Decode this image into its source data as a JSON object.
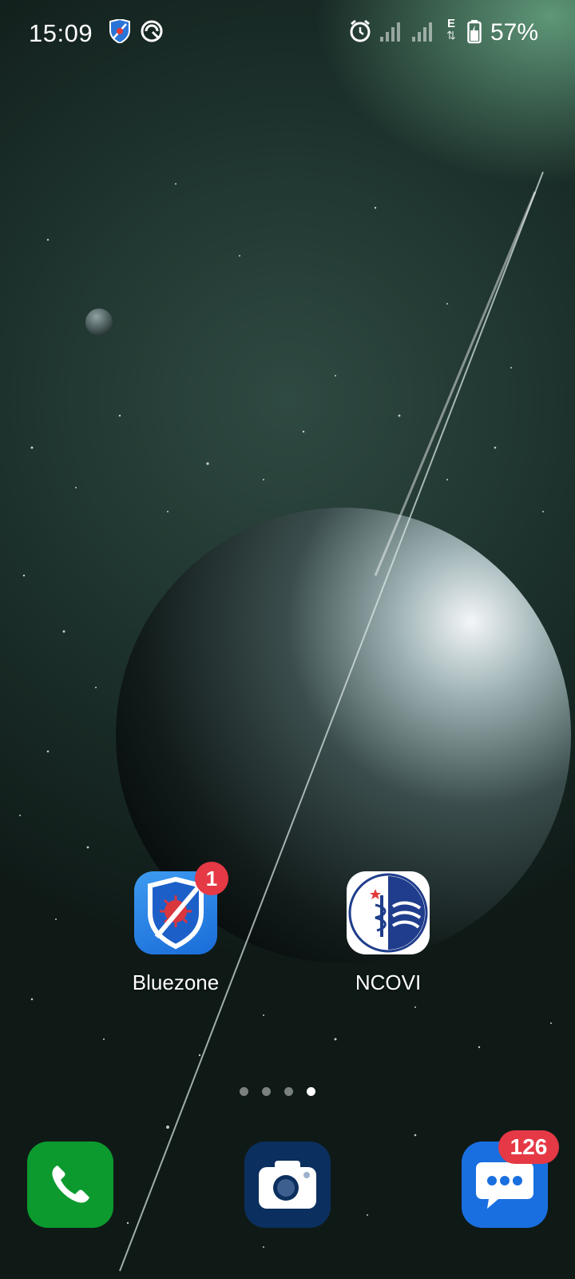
{
  "status_bar": {
    "time": "15:09",
    "battery_percent": "57%",
    "network_type": "E",
    "icons": [
      "bluezone-shield-icon",
      "sync-circle-icon",
      "alarm-icon",
      "signal-icon",
      "signal-icon",
      "data-arrows-icon",
      "battery-icon"
    ]
  },
  "home_apps": [
    {
      "name": "bluezone",
      "label": "Bluezone",
      "badge": "1",
      "color": "#2a86e8"
    },
    {
      "name": "ncovi",
      "label": "NCOVI",
      "badge": "",
      "color": "#1f3d8c"
    }
  ],
  "pager": {
    "pages": 4,
    "active_index": 3
  },
  "dock": [
    {
      "name": "phone",
      "icon": "phone-icon",
      "color": "#0c9a2e",
      "badge": ""
    },
    {
      "name": "camera",
      "icon": "camera-icon",
      "color": "#0b2f5e",
      "badge": ""
    },
    {
      "name": "messages",
      "icon": "chat-bubble-icon",
      "color": "#1a6fe0",
      "badge": "126"
    }
  ]
}
